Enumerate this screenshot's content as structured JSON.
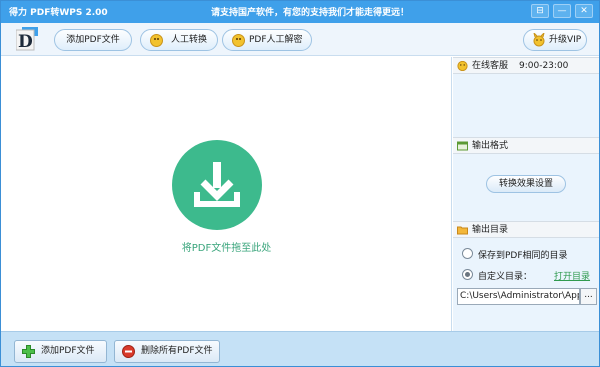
{
  "titlebar": {
    "app_title": "得力 PDF转WPS 2.00",
    "slogan": "请支持国产软件，有您的支持我们才能走得更远！",
    "btn_skin": "⊟",
    "btn_min": "—",
    "btn_close": "✕"
  },
  "toolbar": {
    "logo_letter": "D",
    "add_pdf": "添加PDF文件",
    "manual_convert": "人工转换",
    "pdf_manual_decrypt": "PDF人工解密",
    "upgrade_vip": "升级VIP"
  },
  "main": {
    "drop_hint": "将PDF文件拖至此处"
  },
  "side": {
    "support_title": "在线客服",
    "support_hours": "9:00-23:00",
    "format_title": "输出格式",
    "format_button": "转换效果设置",
    "dir_title": "输出目录",
    "option_same_dir": "保存到PDF相同的目录",
    "option_custom_dir": "自定义目录：",
    "open_dir_link": "打开目录",
    "path_value": "C:\\Users\\Administrator\\App",
    "browse_label": "...",
    "selected_option": "custom"
  },
  "bottom": {
    "add_pdf": "添加PDF文件",
    "delete_all": "删除所有PDF文件"
  },
  "colors": {
    "titlebar": "#3fa0ea",
    "accent_green": "#3dba8d",
    "link_green": "#2f9a4f",
    "delete_red": "#d93a2b"
  }
}
